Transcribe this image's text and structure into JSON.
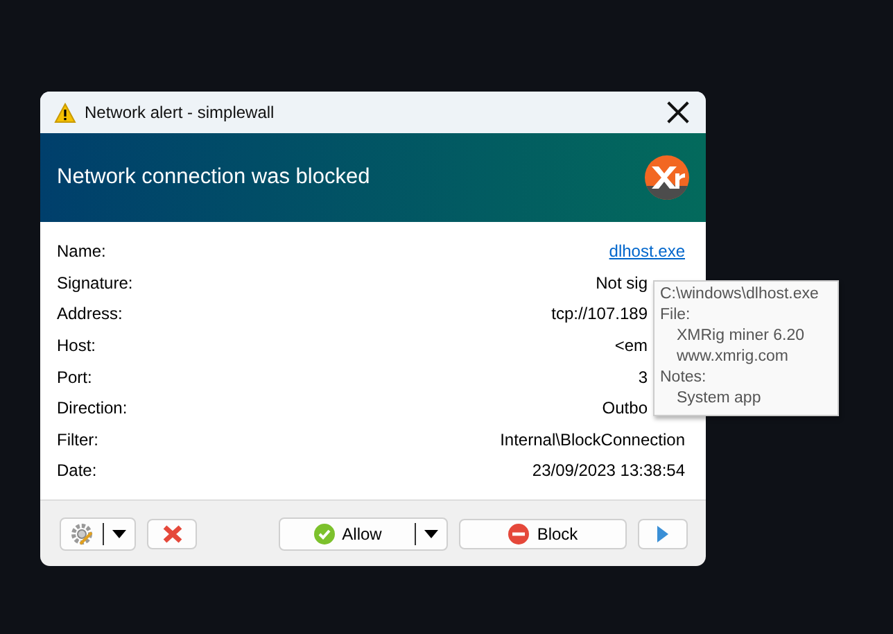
{
  "window": {
    "title": "Network alert - simplewall"
  },
  "header": {
    "title": "Network connection was blocked"
  },
  "fields": [
    {
      "label": "Name:",
      "value": "dlhost.exe",
      "kind": "link"
    },
    {
      "label": "Signature:",
      "value": "Not sig",
      "kind": "text",
      "obscured": true
    },
    {
      "label": "Address:",
      "value": "tcp://107.189",
      "kind": "text",
      "obscured": true
    },
    {
      "label": "Host:",
      "value": "<em",
      "kind": "text",
      "obscured": true
    },
    {
      "label": "Port:",
      "value": "3",
      "kind": "text",
      "obscured": true
    },
    {
      "label": "Direction:",
      "value": "Outbo",
      "kind": "text",
      "obscured": true
    },
    {
      "label": "Filter:",
      "value": "Internal\\BlockConnection",
      "kind": "text"
    },
    {
      "label": "Date:",
      "value": "23/09/2023 13:38:54",
      "kind": "text"
    }
  ],
  "tooltip": {
    "lines": [
      {
        "text": "C:\\windows\\dlhost.exe",
        "kind": "value"
      },
      {
        "text": "File:",
        "kind": "heading"
      },
      {
        "text": "XMRig miner 6.20",
        "kind": "value"
      },
      {
        "text": "www.xmrig.com",
        "kind": "value"
      },
      {
        "text": "Notes:",
        "kind": "heading"
      },
      {
        "text": "System app",
        "kind": "value"
      }
    ]
  },
  "buttons": {
    "allow": "Allow",
    "block": "Block"
  }
}
